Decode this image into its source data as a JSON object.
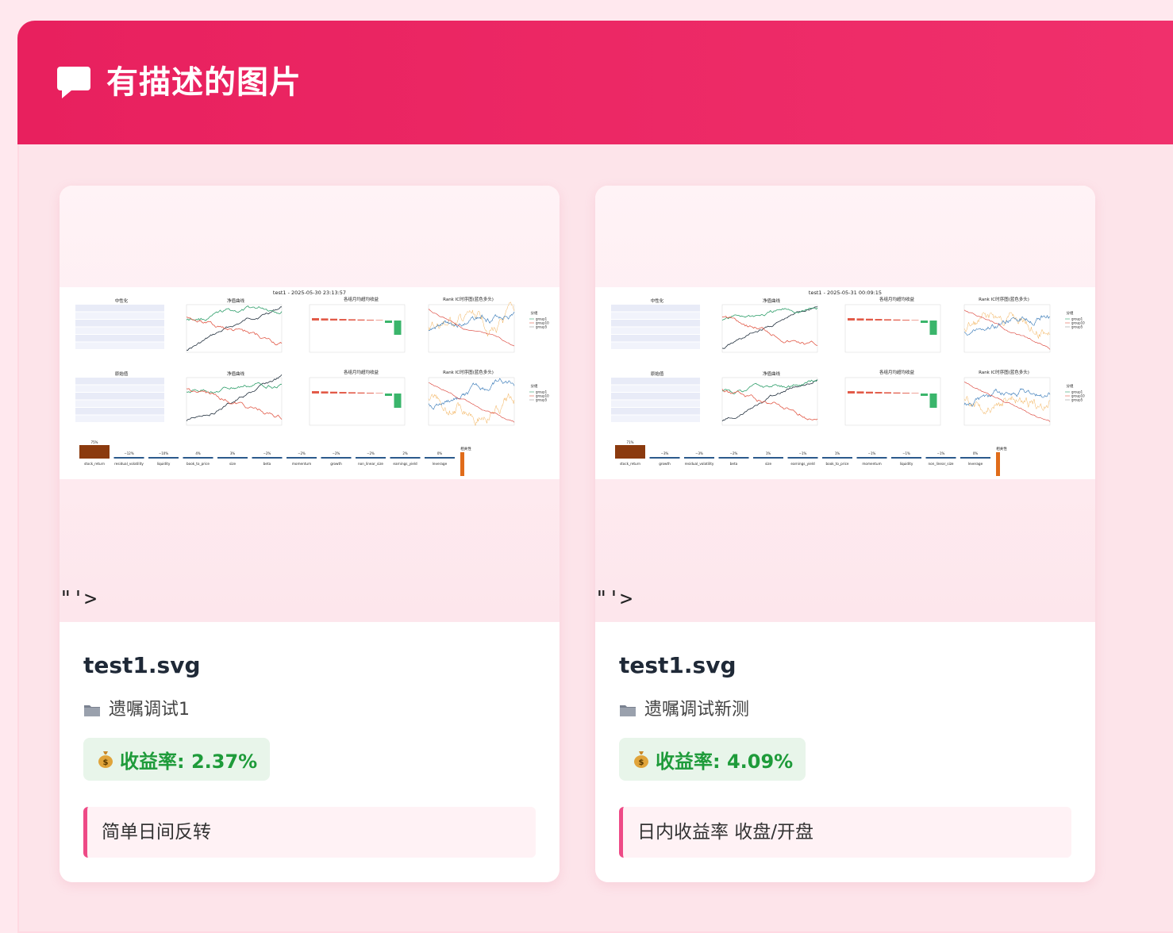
{
  "header": {
    "title": "有描述的图片",
    "icon": "chat-bubble-icon",
    "color_start": "#e8205e",
    "color_end": "#f0306c"
  },
  "cards": [
    {
      "file_name": "test1.svg",
      "stray_text": "\"'>",
      "folder_icon": "folder-icon",
      "folder_name": "遗嘱调试1",
      "return_icon": "money-bag-icon",
      "return_label": "收益率: 2.37%",
      "description": "简单日间反转",
      "preview": {
        "title": "test1 - 2025-05-30 23:13:57",
        "section_top": "中性化",
        "section_bottom": "原始值",
        "panel_nav": "净值曲线",
        "panel_bar": "各组月均超均收益",
        "panel_ic": "Rank IC时序图(蓝色多头)",
        "legend_title": "分组",
        "legend_items": [
          "group1",
          "group10",
          "group5"
        ],
        "corr_label": "相关性",
        "factors": [
          "stock_return",
          "residual_volatility",
          "liquidity",
          "book_to_price",
          "size",
          "beta",
          "momentum",
          "growth",
          "non_linear_size",
          "earnings_yield",
          "leverage"
        ],
        "factor_pcts": [
          "75%",
          "−12%",
          "−10%",
          "4%",
          "3%",
          "−2%",
          "−2%",
          "−2%",
          "−2%",
          "2%",
          "0%"
        ]
      }
    },
    {
      "file_name": "test1.svg",
      "stray_text": "\"'>",
      "folder_icon": "folder-icon",
      "folder_name": "遗嘱调试新测",
      "return_icon": "money-bag-icon",
      "return_label": "收益率: 4.09%",
      "description": "日内收益率 收盘/开盘",
      "preview": {
        "title": "test1 - 2025-05-31 00:09:15",
        "section_top": "中性化",
        "section_bottom": "原始值",
        "panel_nav": "净值曲线",
        "panel_bar": "各组月均超均收益",
        "panel_ic": "Rank IC时序图(蓝色多头)",
        "legend_title": "分组",
        "legend_items": [
          "group1",
          "group10",
          "group5"
        ],
        "corr_label": "相关性",
        "factors": [
          "stock_return",
          "growth",
          "residual_volatility",
          "beta",
          "size",
          "earnings_yield",
          "book_to_price",
          "momentum",
          "liquidity",
          "non_linear_size",
          "leverage"
        ],
        "factor_pcts": [
          "71%",
          "−3%",
          "−3%",
          "−2%",
          "1%",
          "−1%",
          "1%",
          "−1%",
          "−1%",
          "−1%",
          "0%"
        ]
      }
    }
  ],
  "colors": {
    "page_bg": "#ffe8ee",
    "card_bg": "#ffffff",
    "return_green": "#1e9b3a",
    "return_bg": "#e8f5ea",
    "accent_pink": "#ee4a86"
  }
}
